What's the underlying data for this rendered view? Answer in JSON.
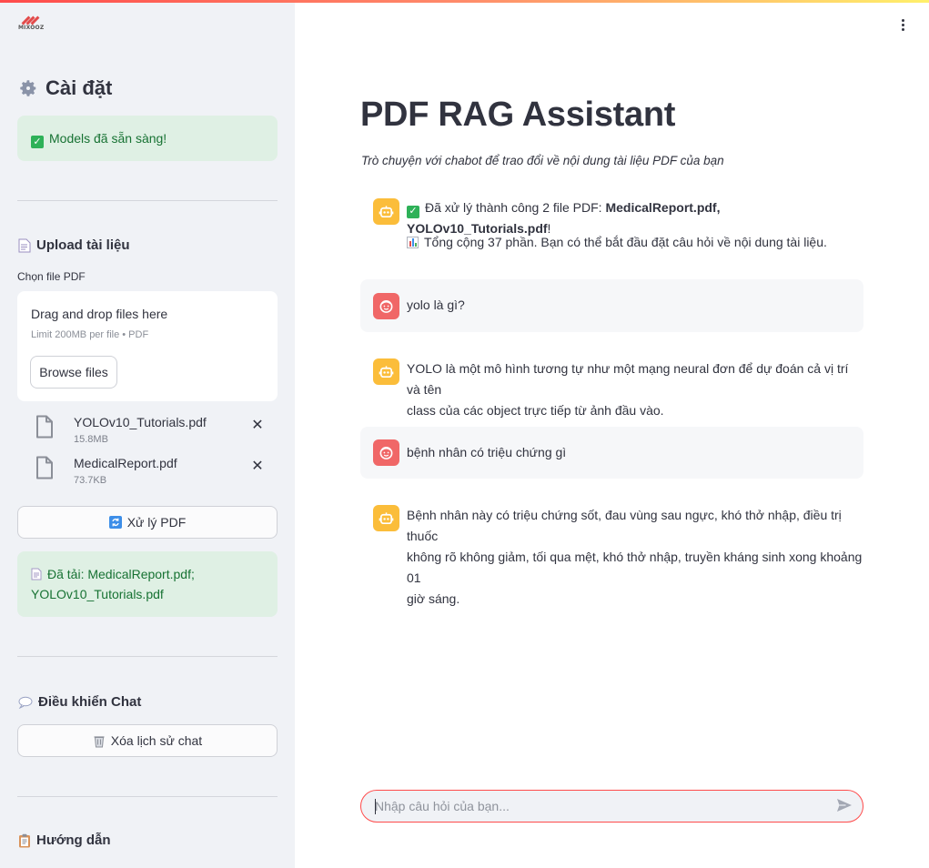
{
  "colors": {
    "accent": "#ff4b4b",
    "success_bg": "#dff0e4",
    "success_text": "#177233",
    "bot_avatar": "#fbbd3a",
    "user_avatar": "#f06767",
    "sidebar_bg": "#f0f2f6"
  },
  "logo": {
    "text": "MIXOOZ"
  },
  "sidebar": {
    "settings_title": "Cài đặt",
    "models_status": "Models đã sẵn sàng!",
    "upload_title": "Upload tài liệu",
    "file_label": "Chọn file PDF",
    "dropzone": {
      "title": "Drag and drop files here",
      "limit": "Limit 200MB per file • PDF",
      "browse_label": "Browse files"
    },
    "files": [
      {
        "name": "YOLOv10_Tutorials.pdf",
        "size": "15.8MB"
      },
      {
        "name": "MedicalReport.pdf",
        "size": "73.7KB"
      }
    ],
    "process_button": "Xử lý PDF",
    "loaded_status": "Đã tải: MedicalReport.pdf; YOLOv10_Tutorials.pdf",
    "chat_control_title": "Điều khiển Chat",
    "clear_button": "Xóa lịch sử chat",
    "guide_title": "Hướng dẫn"
  },
  "main": {
    "title": "PDF RAG Assistant",
    "subtitle": "Trò chuyện với chabot để trao đổi về nội dung tài liệu PDF của bạn",
    "messages": [
      {
        "role": "assistant",
        "prefix": "Đã xử lý thành công 2 file PDF: ",
        "bold": "MedicalReport.pdf, YOLOv10_Tutorials.pdf",
        "suffix": "!",
        "line2": "Tổng cộng 37 phần. Bạn có thể bắt đầu đặt câu hỏi về nội dung tài liệu."
      },
      {
        "role": "user",
        "text": "yolo là gì?"
      },
      {
        "role": "assistant",
        "line1": "YOLO là một mô hình tương tự như một mạng neural đơn để dự đoán cả vị trí và tên",
        "line2": "class của các object trực tiếp từ ảnh đầu vào."
      },
      {
        "role": "user",
        "text": "bệnh nhân có triệu chứng gì"
      },
      {
        "role": "assistant",
        "line1": "Bệnh nhân này có triệu chứng sốt, đau vùng sau ngực, khó thở nhập, điều trị thuốc",
        "line2": "không rõ không giảm, tối qua mệt, khó thở nhập, truyền kháng sinh xong khoảng 01",
        "line3": "giờ sáng."
      }
    ],
    "input_placeholder": "Nhập câu hỏi của bạn..."
  }
}
